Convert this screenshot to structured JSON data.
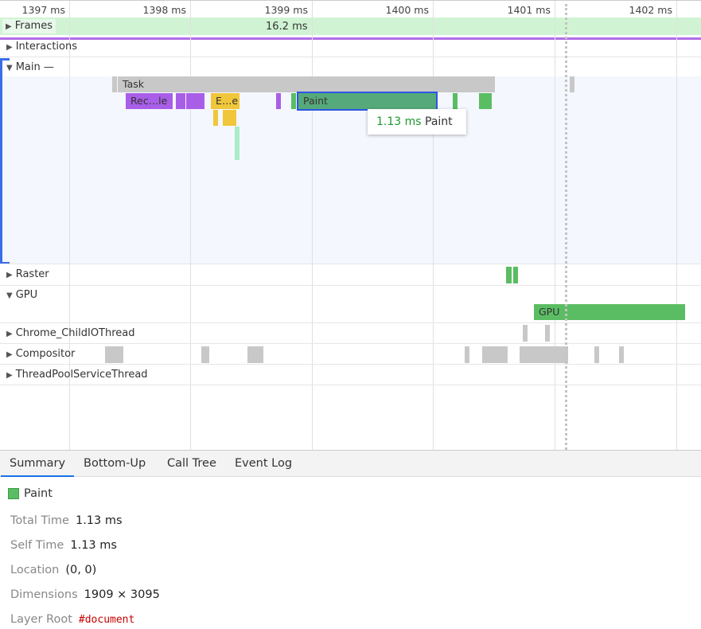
{
  "ruler": {
    "ticks": [
      "1397 ms",
      "1398 ms",
      "1399 ms",
      "1400 ms",
      "1401 ms",
      "1402 ms"
    ]
  },
  "tracks": {
    "frames": {
      "label": "Frames",
      "duration": "16.2 ms"
    },
    "interactions": {
      "label": "Interactions"
    },
    "main": {
      "label": "Main —",
      "events": {
        "task": "Task",
        "recalc": "Rec…le",
        "evaluate": "E…e",
        "paint": "Paint"
      }
    },
    "raster": {
      "label": "Raster"
    },
    "gpu": {
      "label": "GPU",
      "event": "GPU"
    },
    "io": {
      "label": "Chrome_ChildIOThread"
    },
    "compositor": {
      "label": "Compositor"
    },
    "threadpool": {
      "label": "ThreadPoolServiceThread"
    }
  },
  "tooltip": {
    "duration": "1.13 ms",
    "name": "Paint"
  },
  "tabs": [
    "Summary",
    "Bottom-Up",
    "Call Tree",
    "Event Log"
  ],
  "summary": {
    "title": "Paint",
    "color": "#5bbd63",
    "rows": [
      {
        "label": "Total Time",
        "value": "1.13 ms"
      },
      {
        "label": "Self Time",
        "value": "1.13 ms"
      },
      {
        "label": "Location",
        "value": "(0, 0)"
      },
      {
        "label": "Dimensions",
        "value": "1909 × 3095"
      },
      {
        "label": "Layer Root",
        "value": "#document"
      }
    ]
  }
}
